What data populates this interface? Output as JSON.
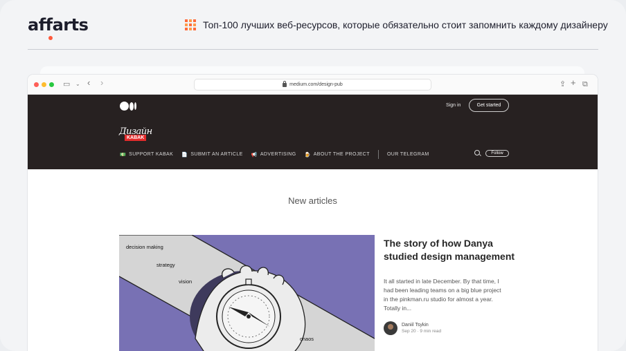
{
  "brand": {
    "logo_text": "affarts"
  },
  "headline": {
    "text": "Топ-100 лучших веб-ресурсов, которые обязательно стоит запомнить каждому дизайнеру"
  },
  "browser": {
    "url": "medium.com/design-pub"
  },
  "medium": {
    "sign_in": "Sign in",
    "get_started": "Get started",
    "publication_logo": {
      "script": "Дизайн",
      "tag": "KABAK"
    },
    "nav": [
      {
        "icon": "banknote-icon",
        "label": "SUPPORT KABAK"
      },
      {
        "icon": "page-icon",
        "label": "SUBMIT AN ARTICLE"
      },
      {
        "icon": "megaphone-icon",
        "label": "ADVERTISING"
      },
      {
        "icon": "beer-icon",
        "label": "ABOUT THE PROJECT"
      },
      {
        "icon": "",
        "label": "OUR TELEGRAM"
      }
    ],
    "follow": "Follow"
  },
  "section": {
    "title": "New articles"
  },
  "article": {
    "illustration_words": [
      "decision making",
      "strategy",
      "vision",
      "chaos"
    ],
    "title": "The story of how Danya studied design management",
    "excerpt": "It all started in late December. By that time, I had been leading teams on a big blue project in the pinkman.ru studio for almost a year. Totally in...",
    "author": "Daniil Tsykin",
    "meta": "Sep 20 · 9 min read"
  },
  "colors": {
    "accent": "#ff5a3c",
    "dark_header": "#272121",
    "illustration_purple": "#7871b4",
    "kabak_red": "#e32b2b"
  }
}
